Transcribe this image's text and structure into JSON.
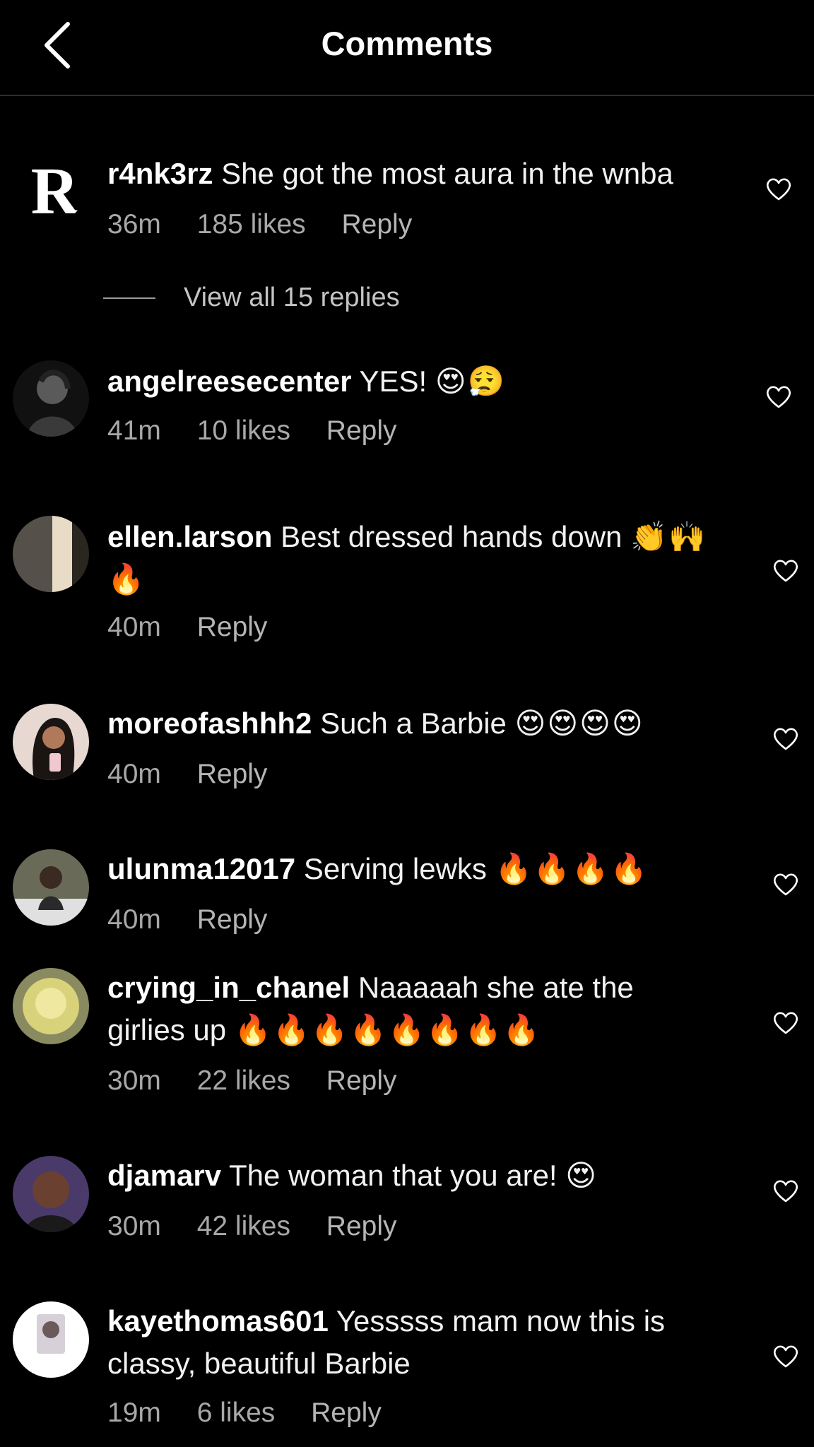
{
  "header": {
    "title": "Comments",
    "back_icon": "chevron-left-icon"
  },
  "comments": [
    {
      "username": "r4nk3rz",
      "text": "She got the most aura in the wnba",
      "time": "36m",
      "likes": "185 likes",
      "reply": "Reply",
      "view_replies": "View all 15 replies"
    },
    {
      "username": "angelreesecenter",
      "text": "YES!",
      "emojis": "😍😮‍💨",
      "time": "41m",
      "likes": "10 likes",
      "reply": "Reply"
    },
    {
      "username": "ellen.larson",
      "text": "Best dressed hands down",
      "emojis": "👏🙌🔥",
      "time": "40m",
      "reply": "Reply"
    },
    {
      "username": "moreofashhh2",
      "text": "Such a Barbie",
      "emojis": "😍😍😍😍",
      "time": "40m",
      "reply": "Reply"
    },
    {
      "username": "ulunma12017",
      "text": "Serving lewks",
      "emojis": "🔥🔥🔥🔥",
      "time": "40m",
      "reply": "Reply"
    },
    {
      "username": "crying_in_chanel",
      "text": "Naaaaah she ate the girlies up",
      "emojis": "🔥🔥🔥🔥🔥🔥🔥🔥",
      "time": "30m",
      "likes": "22 likes",
      "reply": "Reply"
    },
    {
      "username": "djamarv",
      "text": "The woman that you are!",
      "emojis": "😍",
      "time": "30m",
      "likes": "42 likes",
      "reply": "Reply"
    },
    {
      "username": "kayethomas601",
      "text": "Yesssss mam now this is classy, beautiful Barbie",
      "time": "19m",
      "likes": "6 likes",
      "reply": "Reply"
    }
  ],
  "colors": {
    "background": "#000000",
    "text": "#f1f1f1",
    "meta": "#a8a8a8",
    "divider": "#2e2e2e"
  }
}
